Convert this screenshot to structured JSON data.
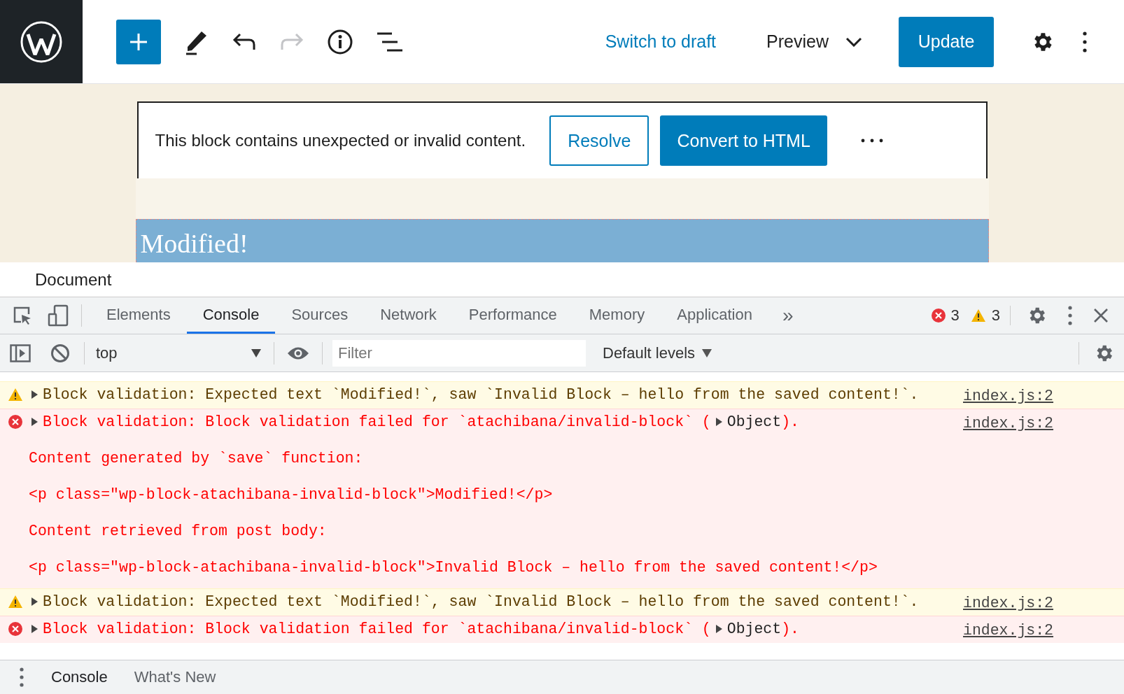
{
  "editor_toolbar": {
    "switch_link": "Switch to draft",
    "preview": "Preview",
    "update": "Update",
    "redo_disabled": true
  },
  "block_warning": {
    "message": "This block contains unexpected or invalid content.",
    "buttons": [
      {
        "label": "Resolve",
        "kind": "secondary"
      },
      {
        "label": "Convert to HTML",
        "kind": "primary"
      }
    ]
  },
  "block": {
    "text": "Modified!"
  },
  "sidebar_header": "Document",
  "devtools": {
    "tabs": [
      {
        "label": "Elements",
        "selected": false
      },
      {
        "label": "Console",
        "selected": true
      },
      {
        "label": "Sources",
        "selected": false
      },
      {
        "label": "Network",
        "selected": false
      },
      {
        "label": "Performance",
        "selected": false
      },
      {
        "label": "Memory",
        "selected": false
      },
      {
        "label": "Application",
        "selected": false
      }
    ],
    "more_tabs": "»",
    "error_count": "3",
    "warning_count": "3",
    "context": "top",
    "filter_placeholder": "Filter",
    "levels": "Default levels",
    "messages": [
      {
        "kind": "warning",
        "expanded": false,
        "text": "Block validation: Expected text `Modified!`, saw `Invalid Block – hello from the saved content!`.",
        "source": "index.js:2"
      },
      {
        "kind": "error",
        "expanded": false,
        "text": "Block validation: Block validation failed for `atachibana/invalid-block` (",
        "object": "Object",
        "tail": ").",
        "source": "index.js:2",
        "details": [
          "Content generated by `save` function:",
          "<p class=\"wp-block-atachibana-invalid-block\">Modified!</p>",
          "Content retrieved from post body:",
          "<p class=\"wp-block-atachibana-invalid-block\">Invalid Block – hello from the saved content!</p>"
        ]
      },
      {
        "kind": "warning",
        "expanded": false,
        "text": "Block validation: Expected text `Modified!`, saw `Invalid Block – hello from the saved content!`.",
        "source": "index.js:2"
      },
      {
        "kind": "error",
        "expanded": false,
        "text": "Block validation: Block validation failed for `atachibana/invalid-block` (",
        "object": "Object",
        "tail": ").",
        "source": "index.js:2"
      }
    ],
    "drawer_tabs": [
      {
        "label": "Console",
        "selected": true
      },
      {
        "label": "What's New",
        "selected": false
      }
    ]
  }
}
